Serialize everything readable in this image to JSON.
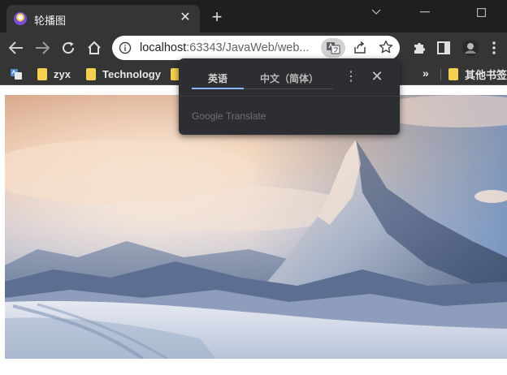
{
  "tab": {
    "title": "轮播图",
    "favicon": "intellij-favicon-icon"
  },
  "window_controls": [
    "minimize",
    "maximize",
    "close"
  ],
  "address_bar": {
    "host": "localhost",
    "path": ":63343/JavaWeb/web..."
  },
  "bookmarks": {
    "items": [
      {
        "label": "zyx"
      },
      {
        "label": "Technology"
      }
    ],
    "overflow": "»",
    "other": "其他书签"
  },
  "translate_popup": {
    "source_lang": "英语",
    "target_lang": "中文（简体）",
    "brand": "Google Translate"
  },
  "colors": {
    "chrome_dark": "#353535",
    "tabstrip": "#1f1f1f",
    "accent": "#8ab4f8"
  }
}
